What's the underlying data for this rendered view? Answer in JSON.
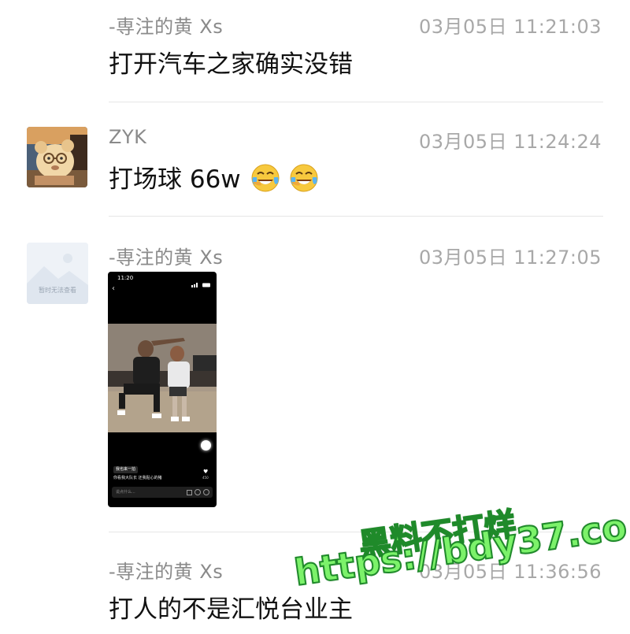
{
  "messages": [
    {
      "sender": "-専注的黄 Xs",
      "time": "03月05日 11:21:03",
      "text": "打开汽车之家确实没错"
    },
    {
      "sender": "ZYK",
      "time": "03月05日 11:24:24",
      "text": "打场球 66w",
      "emoji": "crying-laughing-face"
    },
    {
      "sender": "-専注的黄 Xs",
      "time": "03月05日 11:27:05",
      "avatar_placeholder": "暂时无法查看",
      "image": {
        "status_time": "11:20",
        "caption_chip": "我也来一拍",
        "caption_text": "你看我大队长 还我贴心的猪",
        "like_count": "450",
        "comment_placeholder": "说点什么..."
      }
    },
    {
      "sender": "-専注的黄 Xs",
      "time": "03月05日 11:36:56",
      "text": "打人的不是汇悦台业主"
    }
  ],
  "watermark": {
    "line1": "黑料不打烊",
    "line2": "https://bdy37.co"
  },
  "colors": {
    "sender": "#8a8a8a",
    "time": "#a8a8a8",
    "text": "#111111",
    "divider": "#e6e6e6",
    "watermark": "#7cf26a"
  }
}
